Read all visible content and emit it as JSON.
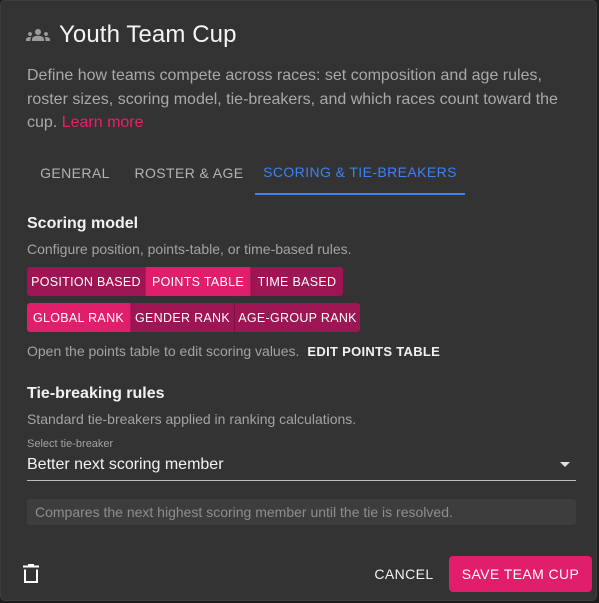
{
  "header": {
    "icon": "group-icon",
    "title": "Youth Team Cup"
  },
  "description": {
    "text": "Define how teams compete across races: set composition and age rules, roster sizes, scoring model, tie-breakers, and which races count toward the cup.",
    "link_label": "Learn more"
  },
  "tabs": [
    {
      "label": "GENERAL",
      "active": false
    },
    {
      "label": "ROSTER & AGE",
      "active": false
    },
    {
      "label": "SCORING & TIE-BREAKERS",
      "active": true
    }
  ],
  "scoring": {
    "title": "Scoring model",
    "subtitle": "Configure position, points-table, or time-based rules.",
    "model_options": [
      {
        "label": "POSITION BASED",
        "selected": false
      },
      {
        "label": "POINTS TABLE",
        "selected": true
      },
      {
        "label": "TIME BASED",
        "selected": false
      }
    ],
    "rank_options": [
      {
        "label": "GLOBAL RANK",
        "selected": true
      },
      {
        "label": "GENDER RANK",
        "selected": false
      },
      {
        "label": "AGE-GROUP RANK",
        "selected": false
      }
    ],
    "points_hint": "Open the points table to edit scoring values.",
    "edit_points_label": "EDIT POINTS TABLE"
  },
  "tiebreak": {
    "title": "Tie-breaking rules",
    "subtitle": "Standard tie-breakers applied in ranking calculations.",
    "select_label": "Select tie-breaker",
    "select_value": "Better next scoring member",
    "helper": "Compares the next highest scoring member until the tie is resolved."
  },
  "footer": {
    "delete_icon": "trash-icon",
    "cancel_label": "CANCEL",
    "save_label": "SAVE TEAM CUP"
  },
  "colors": {
    "accent": "#e01e6b",
    "accent_inactive": "#9d1552",
    "tab_active": "#3b82f6",
    "surface": "#333333"
  }
}
